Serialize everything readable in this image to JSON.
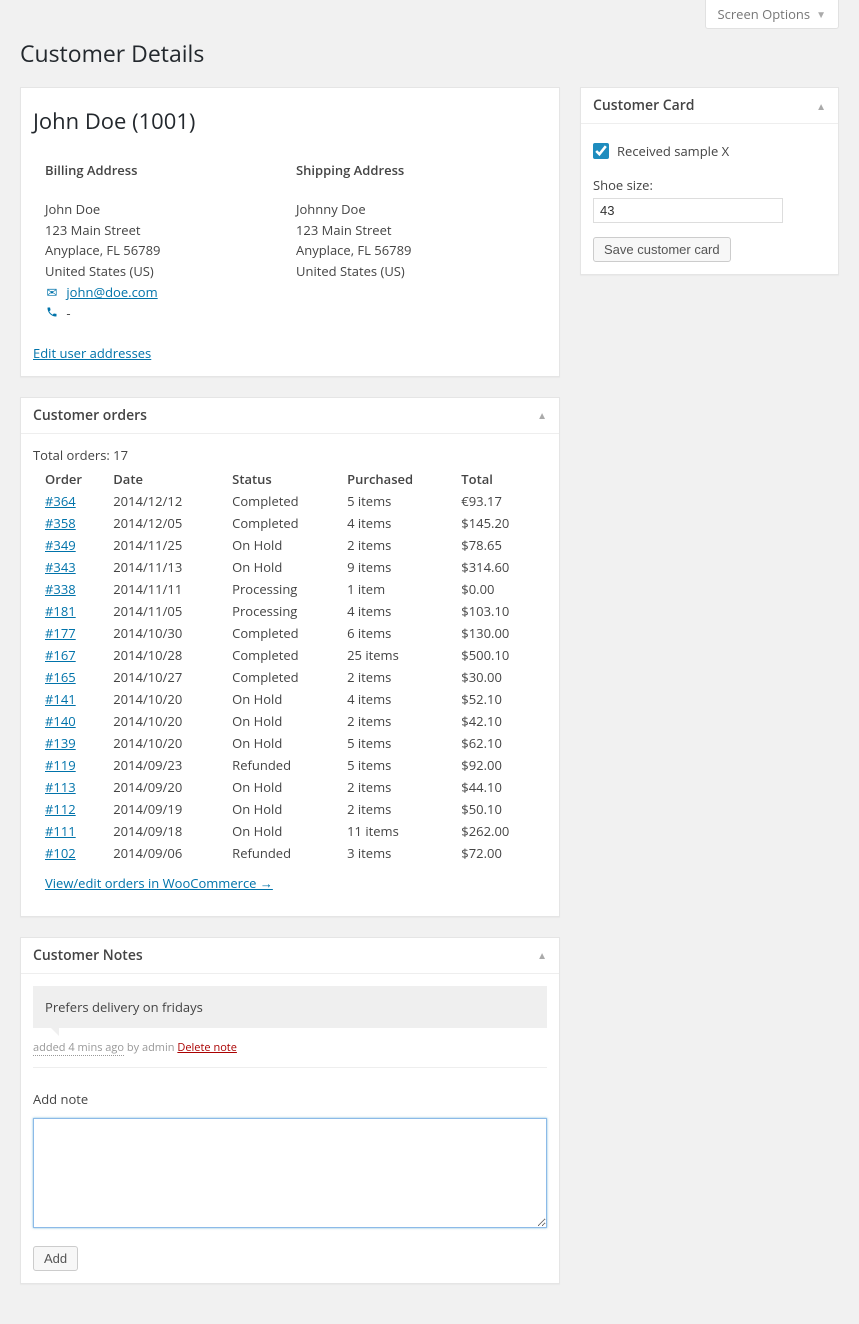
{
  "screen_options": "Screen Options",
  "page_title": "Customer Details",
  "customer_header": "John Doe (1001)",
  "billing": {
    "heading": "Billing Address",
    "name": "John Doe",
    "line1": "123 Main Street",
    "line2": "Anyplace, FL 56789",
    "country": "United States (US)",
    "email": "john@doe.com",
    "phone": "-"
  },
  "shipping": {
    "heading": "Shipping Address",
    "name": "Johnny Doe",
    "line1": "123 Main Street",
    "line2": "Anyplace, FL 56789",
    "country": "United States (US)"
  },
  "edit_addresses": "Edit user addresses",
  "orders_box": {
    "title": "Customer orders",
    "total_label": "Total orders: 17",
    "columns": {
      "order": "Order",
      "date": "Date",
      "status": "Status",
      "purchased": "Purchased",
      "total": "Total"
    },
    "rows": [
      {
        "order": "#364",
        "date": "2014/12/12",
        "status": "Completed",
        "purchased": "5 items",
        "total": "€93.17"
      },
      {
        "order": "#358",
        "date": "2014/12/05",
        "status": "Completed",
        "purchased": "4 items",
        "total": "$145.20"
      },
      {
        "order": "#349",
        "date": "2014/11/25",
        "status": "On Hold",
        "purchased": "2 items",
        "total": "$78.65"
      },
      {
        "order": "#343",
        "date": "2014/11/13",
        "status": "On Hold",
        "purchased": "9 items",
        "total": "$314.60"
      },
      {
        "order": "#338",
        "date": "2014/11/11",
        "status": "Processing",
        "purchased": "1 item",
        "total": "$0.00"
      },
      {
        "order": "#181",
        "date": "2014/11/05",
        "status": "Processing",
        "purchased": "4 items",
        "total": "$103.10"
      },
      {
        "order": "#177",
        "date": "2014/10/30",
        "status": "Completed",
        "purchased": "6 items",
        "total": "$130.00"
      },
      {
        "order": "#167",
        "date": "2014/10/28",
        "status": "Completed",
        "purchased": "25 items",
        "total": "$500.10"
      },
      {
        "order": "#165",
        "date": "2014/10/27",
        "status": "Completed",
        "purchased": "2 items",
        "total": "$30.00"
      },
      {
        "order": "#141",
        "date": "2014/10/20",
        "status": "On Hold",
        "purchased": "4 items",
        "total": "$52.10"
      },
      {
        "order": "#140",
        "date": "2014/10/20",
        "status": "On Hold",
        "purchased": "2 items",
        "total": "$42.10"
      },
      {
        "order": "#139",
        "date": "2014/10/20",
        "status": "On Hold",
        "purchased": "5 items",
        "total": "$62.10"
      },
      {
        "order": "#119",
        "date": "2014/09/23",
        "status": "Refunded",
        "purchased": "5 items",
        "total": "$92.00"
      },
      {
        "order": "#113",
        "date": "2014/09/20",
        "status": "On Hold",
        "purchased": "2 items",
        "total": "$44.10"
      },
      {
        "order": "#112",
        "date": "2014/09/19",
        "status": "On Hold",
        "purchased": "2 items",
        "total": "$50.10"
      },
      {
        "order": "#111",
        "date": "2014/09/18",
        "status": "On Hold",
        "purchased": "11 items",
        "total": "$262.00"
      },
      {
        "order": "#102",
        "date": "2014/09/06",
        "status": "Refunded",
        "purchased": "3 items",
        "total": "$72.00"
      }
    ],
    "view_link": "View/edit orders in WooCommerce →"
  },
  "notes_box": {
    "title": "Customer Notes",
    "note_text": "Prefers delivery on fridays",
    "meta_added": "added 4 mins ago",
    "meta_by": " by admin ",
    "delete": "Delete note",
    "add_label": "Add note",
    "add_button": "Add"
  },
  "card_box": {
    "title": "Customer Card",
    "check_label": "Received sample X",
    "shoe_label": "Shoe size:",
    "shoe_value": "43",
    "save": "Save customer card"
  }
}
